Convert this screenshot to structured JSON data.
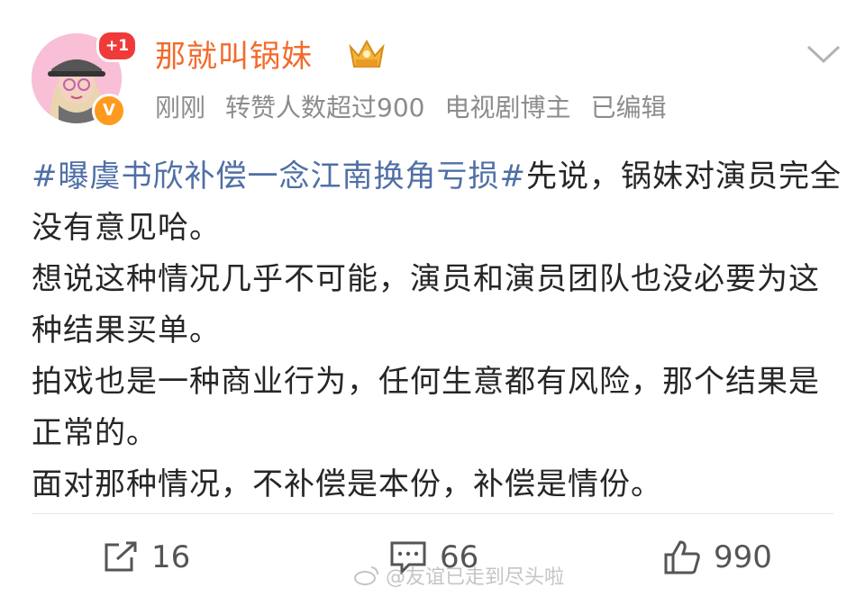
{
  "post": {
    "username": "那就叫锅妹",
    "avatar_badge": "+1",
    "verified_badge": "V",
    "meta": {
      "time": "刚刚",
      "reposts_note": "转赞人数超过900",
      "role": "电视剧博主",
      "edited": "已编辑"
    },
    "hashtag": "#曝虞书欣补偿一念江南换角亏损#",
    "body_first": "先说，锅妹对演员完全没有意见哈。",
    "lines": [
      "想说这种情况几乎不可能，演员和演员团队也没必要为这种结果买单。",
      "拍戏也是一种商业行为，任何生意都有风险，那个结果是正常的。",
      "面对那种情况，不补偿是本份，补偿是情份。"
    ]
  },
  "actions": {
    "repost_count": "16",
    "comment_count": "66",
    "like_count": "990"
  },
  "watermark": "@友谊已走到尽头啦",
  "colors": {
    "username": "#f36a2c",
    "hashtag": "#4f6fa6",
    "badge_red": "#f03a3a",
    "badge_orange": "#ff9a1e"
  },
  "icons": {
    "crown": "crown-badge-icon",
    "chevron": "chevron-down-icon",
    "repost": "repost-icon",
    "comment": "comment-icon",
    "like": "thumbs-up-icon",
    "weibo": "weibo-logo-icon"
  }
}
